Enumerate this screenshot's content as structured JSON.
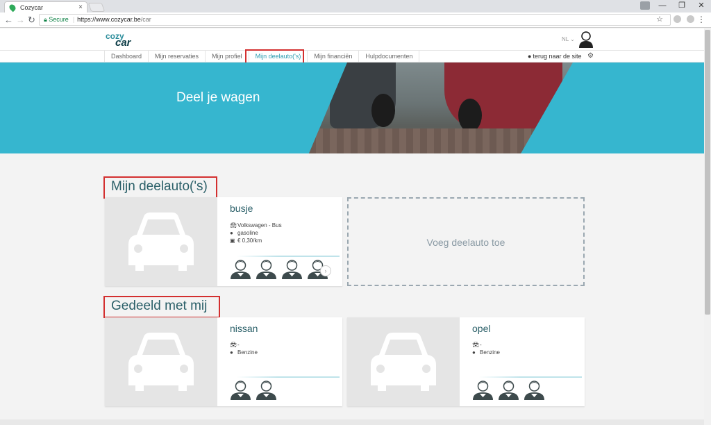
{
  "browser": {
    "tab_title": "Cozycar",
    "tab_close": "×",
    "secure_label": "Secure",
    "url_host": "https://www.cozycar.be",
    "url_path": "/car",
    "window_buttons": [
      "—",
      "❐",
      "✕"
    ]
  },
  "header": {
    "logo_line1": "cozy",
    "logo_line2": "car",
    "language": "NL ⌄"
  },
  "nav": {
    "items": [
      "Dashboard",
      "Mijn reservaties",
      "Mijn profiel",
      "Mijn deelauto('s)",
      "Mijn financiën",
      "Hulpdocumenten"
    ],
    "active_index": 3,
    "back_to_site": "terug naar de site"
  },
  "hero": {
    "title": "Deel je wagen"
  },
  "my_cars": {
    "section_title": "Mijn deelauto('s)",
    "cars": [
      {
        "name": "busje",
        "model": "Volkswagen - Bus",
        "fuel": "gasoline",
        "price": "€ 0,30/km",
        "members": 4
      }
    ],
    "add_label": "Voeg deelauto toe"
  },
  "shared": {
    "section_title": "Gedeeld met mij",
    "cars": [
      {
        "name": "nissan",
        "model": "-",
        "fuel": "Benzine",
        "members": 2
      },
      {
        "name": "opel",
        "model": "-",
        "fuel": "Benzine",
        "members": 3
      }
    ]
  },
  "colors": {
    "accent": "#36b6cf",
    "heading": "#2a5f68",
    "highlight": "#d32f2f"
  },
  "icons": [
    "car-icon",
    "fuel-drop-icon",
    "price-icon",
    "globe-icon",
    "gear-icon",
    "chevron-right-icon"
  ]
}
